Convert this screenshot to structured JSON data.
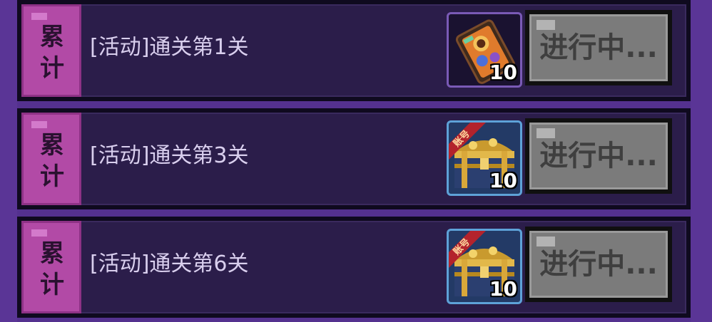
{
  "tasks": [
    {
      "tag": "累计",
      "title": "[活动]通关第1关",
      "reward": {
        "icon": "card-pack-icon",
        "count": "10",
        "badge": ""
      },
      "status": "进行中..."
    },
    {
      "tag": "累计",
      "title": "[活动]通关第3关",
      "reward": {
        "icon": "treasure-chest-icon",
        "count": "10",
        "badge": "账号"
      },
      "status": "进行中..."
    },
    {
      "tag": "累计",
      "title": "[活动]通关第6关",
      "reward": {
        "icon": "treasure-chest-icon",
        "count": "10",
        "badge": "账号"
      },
      "status": "进行中..."
    }
  ],
  "colors": {
    "background": "#54318f",
    "row_fill": "#2b1d4a",
    "tag_fill": "#b24aa6",
    "button_fill": "#7b7b7b",
    "title_text": "#d9cfee"
  }
}
